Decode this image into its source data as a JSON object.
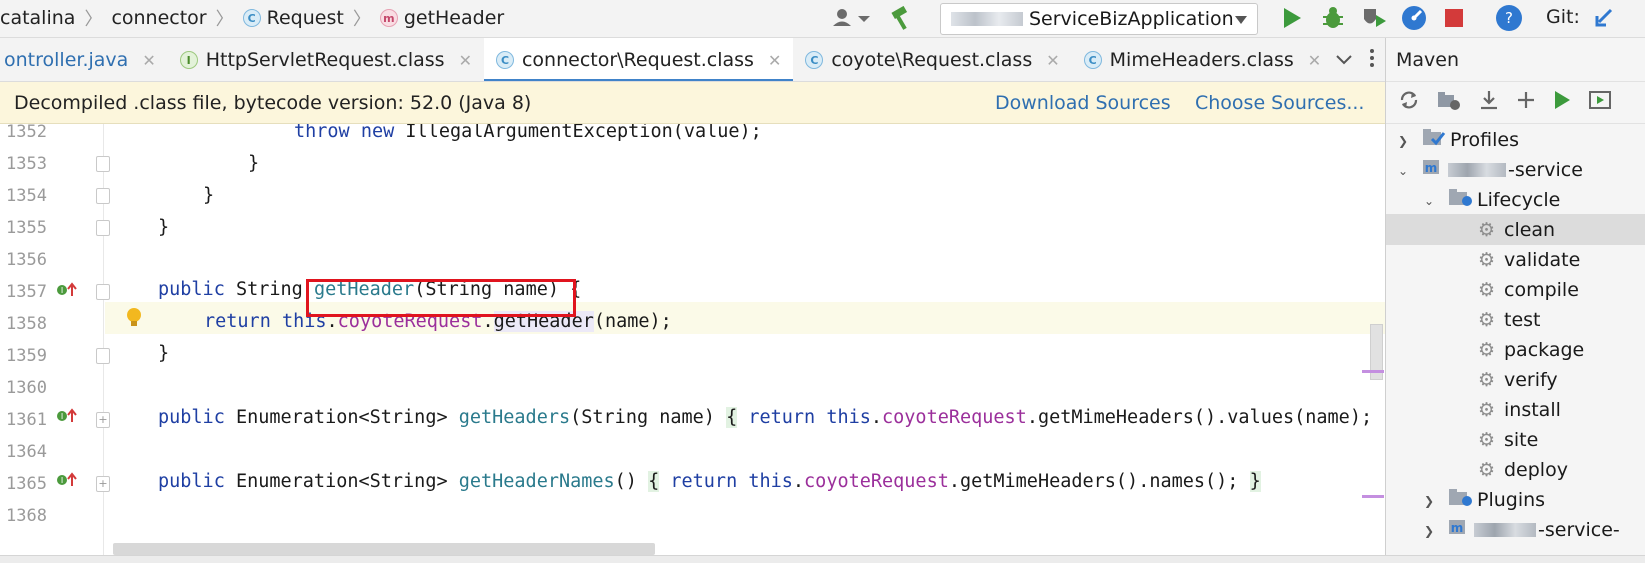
{
  "breadcrumb": {
    "items": [
      "catalina",
      "connector",
      "Request",
      "getHeader"
    ],
    "request_icon": "C",
    "method_icon": "m"
  },
  "toolbar": {
    "run_config": "ServiceBizApplication",
    "git_label": "Git:",
    "icons": [
      "user-icon",
      "hammer-icon",
      "run-icon",
      "debug-icon",
      "coverage-icon",
      "profiler-icon",
      "stop-icon",
      "search-everywhere-icon",
      "git-update-icon"
    ]
  },
  "tabs": [
    {
      "label": "ontroller.java",
      "icon": "",
      "active": false
    },
    {
      "label": "HttpServletRequest.class",
      "icon": "I",
      "active": false
    },
    {
      "label": "connector\\Request.class",
      "icon": "C",
      "active": true
    },
    {
      "label": "coyote\\Request.class",
      "icon": "C",
      "active": false
    },
    {
      "label": "MimeHeaders.class",
      "icon": "C",
      "active": false
    }
  ],
  "banner": {
    "message": "Decompiled .class file, bytecode version: 52.0 (Java 8)",
    "download_sources": "Download Sources",
    "choose_sources": "Choose Sources..."
  },
  "editor": {
    "line_numbers": [
      "1352",
      "1353",
      "1354",
      "1355",
      "1356",
      "1357",
      "1358",
      "1359",
      "1360",
      "1361",
      "1364",
      "1365",
      "1368"
    ],
    "lines": {
      "l1352_kw1": "throw",
      "l1352_kw2": "new",
      "l1352_rest": "IllegalArgumentException(value);",
      "l1353": "}",
      "l1354": "}",
      "l1355": "}",
      "l1357_kw": "public",
      "l1357_type": "String",
      "l1357_method": "getHeader",
      "l1357_args": "(String name)",
      "l1357_brace": "{",
      "l1358_kw": "return",
      "l1358_this": "this",
      "l1358_field": "coyoteRequest",
      "l1358_call": "getHeader",
      "l1358_args": "(name);",
      "l1359": "}",
      "l1361_kw": "public",
      "l1361_type": "Enumeration<String>",
      "l1361_method": "getHeaders",
      "l1361_args": "(String name)",
      "l1361_brace": "{",
      "l1361_ret": "return",
      "l1361_this": "this",
      "l1361_field": "coyoteRequest",
      "l1361_rest": ".getMimeHeaders().values(name);",
      "l1365_kw": "public",
      "l1365_type": "Enumeration<String>",
      "l1365_method": "getHeaderNames",
      "l1365_args": "()",
      "l1365_brace": "{",
      "l1365_ret": "return",
      "l1365_this": "this",
      "l1365_field": "coyoteRequest",
      "l1365_rest": ".getMimeHeaders().names();",
      "l1365_close": "}"
    }
  },
  "maven": {
    "title": "Maven",
    "tree": [
      {
        "label": "Profiles",
        "kind": "profiles"
      },
      {
        "label": "-service",
        "kind": "module"
      },
      {
        "label": "Lifecycle",
        "kind": "folder"
      },
      {
        "label": "clean",
        "kind": "goal",
        "selected": true
      },
      {
        "label": "validate",
        "kind": "goal"
      },
      {
        "label": "compile",
        "kind": "goal"
      },
      {
        "label": "test",
        "kind": "goal"
      },
      {
        "label": "package",
        "kind": "goal"
      },
      {
        "label": "verify",
        "kind": "goal"
      },
      {
        "label": "install",
        "kind": "goal"
      },
      {
        "label": "site",
        "kind": "goal"
      },
      {
        "label": "deploy",
        "kind": "goal"
      },
      {
        "label": "Plugins",
        "kind": "folder"
      },
      {
        "label": "-service-",
        "kind": "module"
      }
    ]
  },
  "colors": {
    "accent": "#4083c9",
    "keyword": "#1f3fa3",
    "method": "#2a7a8c",
    "field": "#9b2f9b",
    "highlight_box": "#e0141e",
    "banner_bg": "#fcf6dc"
  }
}
